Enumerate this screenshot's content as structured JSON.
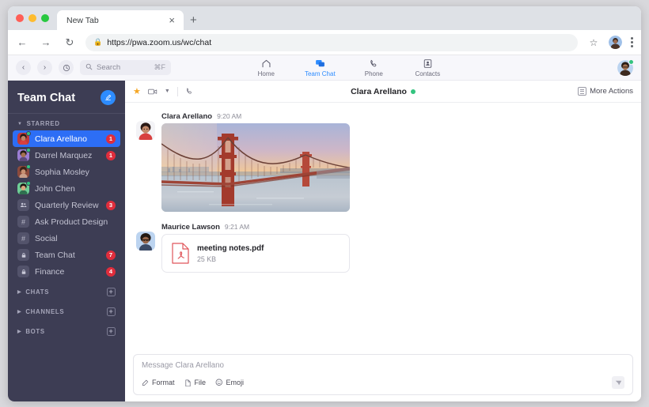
{
  "browser": {
    "tab_title": "New Tab",
    "tab_close_icon": "close-icon",
    "new_tab_icon": "plus-icon",
    "back_icon": "arrow-left-icon",
    "forward_icon": "arrow-right-icon",
    "reload_icon": "reload-icon",
    "lock_icon": "lock-icon",
    "url": "https://pwa.zoom.us/wc/chat",
    "bookmark_icon": "star-outline-icon",
    "profile_icon": "profile-avatar-icon",
    "menu_icon": "kebab-menu-icon"
  },
  "appnav": {
    "back_icon": "chevron-left-icon",
    "forward_icon": "chevron-right-icon",
    "history_icon": "clock-history-icon",
    "search_placeholder": "Search",
    "search_shortcut": "⌘F",
    "tabs": [
      {
        "label": "Home",
        "icon": "home-icon",
        "active": false
      },
      {
        "label": "Team Chat",
        "icon": "chat-bubbles-icon",
        "active": true
      },
      {
        "label": "Phone",
        "icon": "phone-icon",
        "active": false
      },
      {
        "label": "Contacts",
        "icon": "contacts-card-icon",
        "active": false
      }
    ],
    "avatar_status": "online"
  },
  "sidebar": {
    "title": "Team Chat",
    "compose_icon": "compose-pencil-icon",
    "groups": [
      {
        "label": "STARRED",
        "expanded": true,
        "has_add": false
      },
      {
        "label": "CHATS",
        "expanded": false,
        "has_add": true
      },
      {
        "label": "CHANNELS",
        "expanded": false,
        "has_add": true
      },
      {
        "label": "BOTS",
        "expanded": false,
        "has_add": true
      }
    ],
    "items": [
      {
        "name": "Clara Arellano",
        "type": "avatar",
        "avatar": "clara",
        "presence": "online",
        "badge": "1",
        "active": true
      },
      {
        "name": "Darrel Marquez",
        "type": "avatar",
        "avatar": "darrel",
        "presence": "online",
        "badge": "1",
        "active": false
      },
      {
        "name": "Sophia Mosley",
        "type": "avatar",
        "avatar": "sophia",
        "presence": "online",
        "badge": "",
        "active": false
      },
      {
        "name": "John Chen",
        "type": "avatar",
        "avatar": "john",
        "presence": "online",
        "badge": "",
        "active": false
      },
      {
        "name": "Quarterly Review",
        "type": "group",
        "icon": "group-people-icon",
        "badge": "3",
        "active": false
      },
      {
        "name": "Ask Product Design",
        "type": "channel",
        "icon": "hash-icon",
        "badge": "",
        "active": false
      },
      {
        "name": "Social",
        "type": "channel",
        "icon": "hash-icon",
        "badge": "",
        "active": false
      },
      {
        "name": "Team Chat",
        "type": "private",
        "icon": "lock-icon",
        "badge": "7",
        "active": false
      },
      {
        "name": "Finance",
        "type": "private",
        "icon": "lock-icon",
        "badge": "4",
        "active": false
      }
    ],
    "add_icon": "plus-square-icon"
  },
  "chat_header": {
    "star_icon": "star-filled-icon",
    "video_icon": "video-camera-icon",
    "video_caret_icon": "chevron-down-icon",
    "phone_icon": "phone-handset-icon",
    "title": "Clara Arellano",
    "presence": "online",
    "more_actions_label": "More Actions",
    "more_actions_icon": "list-lines-icon"
  },
  "messages": [
    {
      "author": "Clara Arellano",
      "time": "9:20 AM",
      "avatar": "clara",
      "kind": "image",
      "image_alt": "Golden Gate Bridge at sunset"
    },
    {
      "author": "Maurice Lawson",
      "time": "9:21 AM",
      "avatar": "maurice",
      "kind": "file",
      "file_name": "meeting notes.pdf",
      "file_size": "25 KB",
      "file_icon": "pdf-file-icon"
    }
  ],
  "composer": {
    "placeholder": "Message Clara Arellano",
    "value": "",
    "tools": [
      {
        "label": "Format",
        "icon": "format-text-icon"
      },
      {
        "label": "File",
        "icon": "file-page-icon"
      },
      {
        "label": "Emoji",
        "icon": "emoji-smiley-icon"
      }
    ],
    "send_icon": "send-paperplane-icon"
  },
  "colors": {
    "sidebar_bg": "#3D3D54",
    "sidebar_active": "#2D6EF5",
    "accent_blue": "#2D8CFF",
    "badge_red": "#E02D3C",
    "online_green": "#33C47F",
    "star_orange": "#F5A623",
    "appnav_bg": "#F7F7FB"
  }
}
